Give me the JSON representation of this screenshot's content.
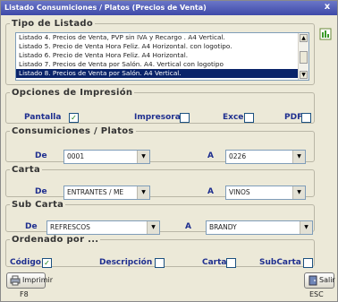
{
  "window": {
    "title": "Listado Consumiciones / Platos (Precios de Venta)",
    "close_glyph": "x"
  },
  "tipo_listado": {
    "legend": "Tipo de Listado",
    "items": [
      "Listado 4. Precios de Venta, PVP sin IVA y Recargo . A4 Vertical.",
      "Listado 5. Precio de Venta Hora Feliz. A4 Horizontal. con logotipo.",
      "Listado 6. Precio de Venta Hora Feliz. A4 Horizontal.",
      "Listado 7. Precios de Venta por Salón. A4. Vertical con logotipo",
      "Listado 8. Precios de Venta por Salón. A4 Vertical."
    ],
    "selected_index": 4
  },
  "opciones": {
    "legend": "Opciones de Impresión",
    "pantalla": "Pantalla",
    "impresora": "Impresora",
    "excel": "Excel",
    "pdf": "PDF",
    "check_mark": "✓"
  },
  "consumiciones": {
    "legend": "Consumiciones / Platos",
    "de_label": "De",
    "de_value": "0001",
    "a_label": "A",
    "a_value": "0226"
  },
  "carta": {
    "legend": "Carta",
    "de_label": "De",
    "de_value": "ENTRANTES / ME",
    "a_label": "A",
    "a_value": "VINOS"
  },
  "subcarta": {
    "legend": "Sub Carta",
    "de_label": "De",
    "de_value": "REFRESCOS",
    "a_label": "A",
    "a_value": "BRANDY"
  },
  "ordenado": {
    "legend": "Ordenado por ...",
    "codigo": "Código",
    "descripcion": "Descripción",
    "carta": "Carta",
    "subcarta": "SubCarta"
  },
  "footer": {
    "imprimir_label": "Imprimir",
    "imprimir_key": "F8",
    "salir_label": "Salir",
    "salir_key": "ESC"
  },
  "colors": {
    "title_bar": "#3e49a8",
    "selection": "#0a246a",
    "label_blue": "#1f2f8f",
    "check_green": "#0b7a0b"
  }
}
